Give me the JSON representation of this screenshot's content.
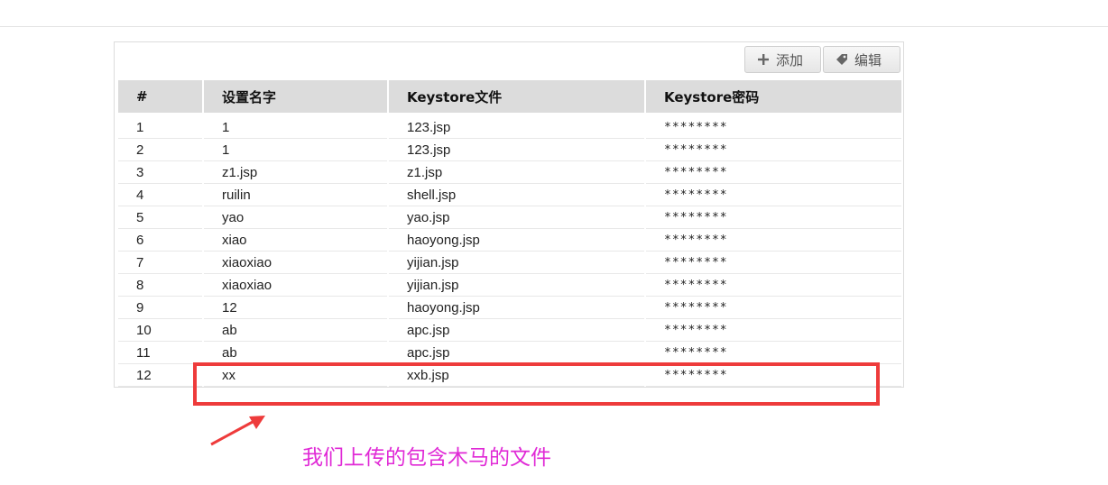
{
  "toolbar": {
    "add_label": "添加",
    "edit_label": "编辑"
  },
  "table": {
    "columns": [
      "#",
      "设置名字",
      "Keystore文件",
      "Keystore密码"
    ],
    "rows": [
      {
        "num": "1",
        "name": "1",
        "file": "123.jsp",
        "password": "********"
      },
      {
        "num": "2",
        "name": "1",
        "file": "123.jsp",
        "password": "********"
      },
      {
        "num": "3",
        "name": "z1.jsp",
        "file": "z1.jsp",
        "password": "********"
      },
      {
        "num": "4",
        "name": "ruilin",
        "file": "shell.jsp",
        "password": "********"
      },
      {
        "num": "5",
        "name": "yao",
        "file": "yao.jsp",
        "password": "********"
      },
      {
        "num": "6",
        "name": "xiao",
        "file": "haoyong.jsp",
        "password": "********"
      },
      {
        "num": "7",
        "name": "xiaoxiao",
        "file": "yijian.jsp",
        "password": "********"
      },
      {
        "num": "8",
        "name": "xiaoxiao",
        "file": "yijian.jsp",
        "password": "********"
      },
      {
        "num": "9",
        "name": "12",
        "file": "haoyong.jsp",
        "password": "********"
      },
      {
        "num": "10",
        "name": "ab",
        "file": "apc.jsp",
        "password": "********"
      },
      {
        "num": "11",
        "name": "ab",
        "file": "apc.jsp",
        "password": "********"
      },
      {
        "num": "12",
        "name": "xx",
        "file": "xxb.jsp",
        "password": "********"
      }
    ]
  },
  "annotation": {
    "text": "我们上传的包含木马的文件",
    "text_color": "#e02ad6",
    "box_color": "#ee3b3b"
  },
  "icons": {
    "add": "plus-icon",
    "edit": "tag-icon"
  }
}
